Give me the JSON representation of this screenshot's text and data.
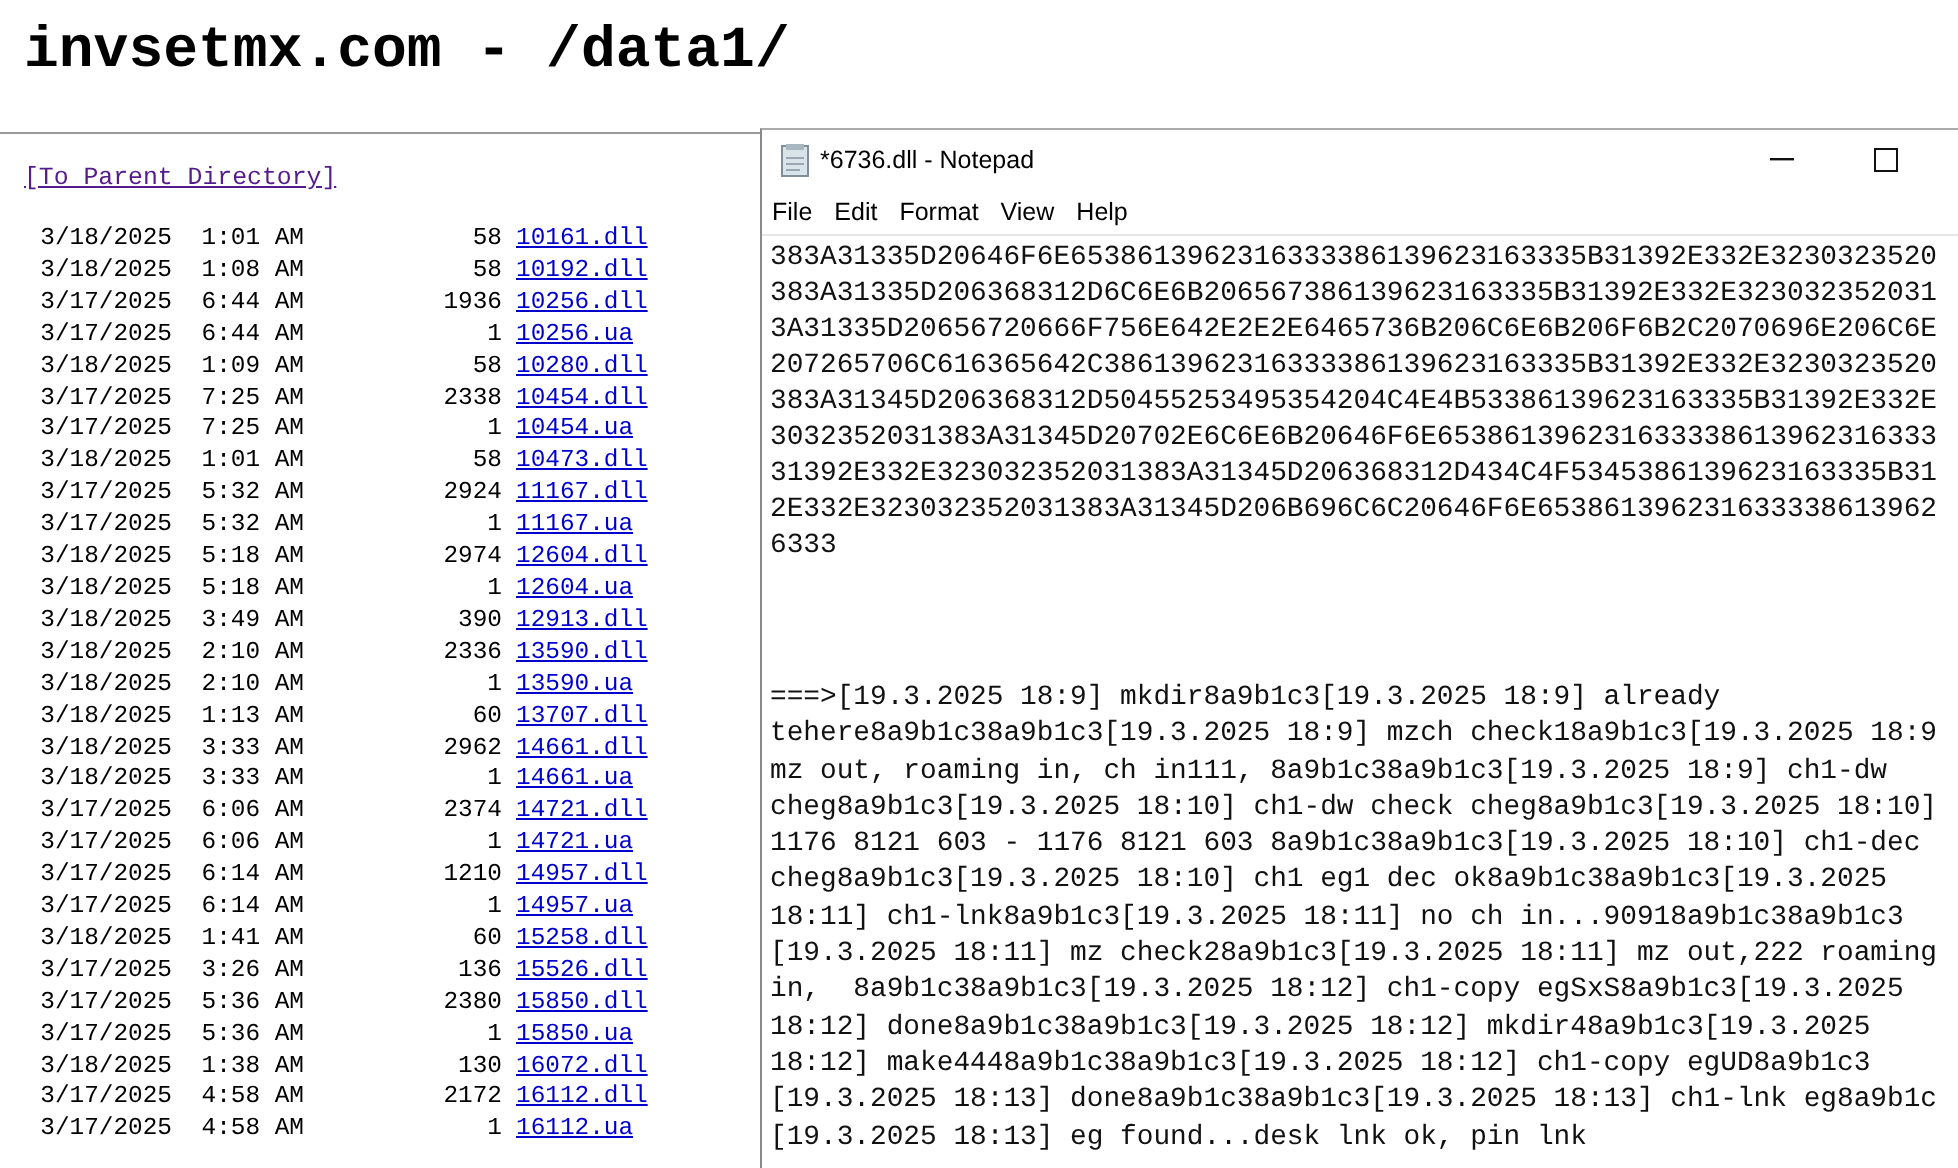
{
  "page": {
    "title": "invsetmx.com - /data1/",
    "parent_link": "[To Parent Directory]",
    "files": [
      {
        "date": "3/18/2025",
        "time": "1:01 AM",
        "size": "58",
        "name": "10161.dll"
      },
      {
        "date": "3/18/2025",
        "time": "1:08 AM",
        "size": "58",
        "name": "10192.dll"
      },
      {
        "date": "3/17/2025",
        "time": "6:44 AM",
        "size": "1936",
        "name": "10256.dll"
      },
      {
        "date": "3/17/2025",
        "time": "6:44 AM",
        "size": "1",
        "name": "10256.ua"
      },
      {
        "date": "3/18/2025",
        "time": "1:09 AM",
        "size": "58",
        "name": "10280.dll"
      },
      {
        "date": "3/17/2025",
        "time": "7:25 AM",
        "size": "2338",
        "name": "10454.dll"
      },
      {
        "date": "3/17/2025",
        "time": "7:25 AM",
        "size": "1",
        "name": "10454.ua"
      },
      {
        "date": "3/18/2025",
        "time": "1:01 AM",
        "size": "58",
        "name": "10473.dll"
      },
      {
        "date": "3/17/2025",
        "time": "5:32 AM",
        "size": "2924",
        "name": "11167.dll"
      },
      {
        "date": "3/17/2025",
        "time": "5:32 AM",
        "size": "1",
        "name": "11167.ua"
      },
      {
        "date": "3/18/2025",
        "time": "5:18 AM",
        "size": "2974",
        "name": "12604.dll"
      },
      {
        "date": "3/18/2025",
        "time": "5:18 AM",
        "size": "1",
        "name": "12604.ua"
      },
      {
        "date": "3/18/2025",
        "time": "3:49 AM",
        "size": "390",
        "name": "12913.dll"
      },
      {
        "date": "3/18/2025",
        "time": "2:10 AM",
        "size": "2336",
        "name": "13590.dll"
      },
      {
        "date": "3/18/2025",
        "time": "2:10 AM",
        "size": "1",
        "name": "13590.ua"
      },
      {
        "date": "3/18/2025",
        "time": "1:13 AM",
        "size": "60",
        "name": "13707.dll"
      },
      {
        "date": "3/18/2025",
        "time": "3:33 AM",
        "size": "2962",
        "name": "14661.dll"
      },
      {
        "date": "3/18/2025",
        "time": "3:33 AM",
        "size": "1",
        "name": "14661.ua"
      },
      {
        "date": "3/17/2025",
        "time": "6:06 AM",
        "size": "2374",
        "name": "14721.dll"
      },
      {
        "date": "3/17/2025",
        "time": "6:06 AM",
        "size": "1",
        "name": "14721.ua"
      },
      {
        "date": "3/17/2025",
        "time": "6:14 AM",
        "size": "1210",
        "name": "14957.dll"
      },
      {
        "date": "3/17/2025",
        "time": "6:14 AM",
        "size": "1",
        "name": "14957.ua"
      },
      {
        "date": "3/18/2025",
        "time": "1:41 AM",
        "size": "60",
        "name": "15258.dll"
      },
      {
        "date": "3/17/2025",
        "time": "3:26 AM",
        "size": "136",
        "name": "15526.dll"
      },
      {
        "date": "3/17/2025",
        "time": "5:36 AM",
        "size": "2380",
        "name": "15850.dll"
      },
      {
        "date": "3/17/2025",
        "time": "5:36 AM",
        "size": "1",
        "name": "15850.ua"
      },
      {
        "date": "3/18/2025",
        "time": "1:38 AM",
        "size": "130",
        "name": "16072.dll"
      },
      {
        "date": "3/17/2025",
        "time": "4:58 AM",
        "size": "2172",
        "name": "16112.dll"
      },
      {
        "date": "3/17/2025",
        "time": "4:58 AM",
        "size": "1",
        "name": "16112.ua"
      }
    ]
  },
  "notepad": {
    "title": "*6736.dll - Notepad",
    "menu": [
      "File",
      "Edit",
      "Format",
      "View",
      "Help"
    ],
    "hex_lines": [
      "383A31335D20646F6E6538613962316333386139623163335B31392E332E3230323520",
      "383A31335D206368312D6C6E6B206567386139623163335B31392E332E323032352031",
      "3A31335D20656720666F756E642E2E2E6465736B206C6E6B206F6B2C2070696E206C6E",
      "207265706C616365642C38613962316333386139623163335B31392E332E3230323520",
      "383A31345D206368312D50455253495354204C4E4B53386139623163335B31392E332E",
      "3032352031383A31345D20702E6C6E6B20646F6E653861396231633338613962316333",
      "31392E332E323032352031383A31345D206368312D434C4F5345386139623163335B31",
      "2E332E323032352031383A31345D206B696C6C20646F6E653861396231633338613962",
      "6333"
    ],
    "log_lines": [
      "===>[19.3.2025 18:9] mkdir8a9b1c3[19.3.2025 18:9] already",
      "tehere8a9b1c38a9b1c3[19.3.2025 18:9] mzch check18a9b1c3[19.3.2025 18:9",
      "mz out, roaming in, ch in111, 8a9b1c38a9b1c3[19.3.2025 18:9] ch1-dw",
      "cheg8a9b1c3[19.3.2025 18:10] ch1-dw check cheg8a9b1c3[19.3.2025 18:10]",
      "1176 8121 603 - 1176 8121 603 8a9b1c38a9b1c3[19.3.2025 18:10] ch1-dec",
      "cheg8a9b1c3[19.3.2025 18:10] ch1 eg1 dec ok8a9b1c38a9b1c3[19.3.2025",
      "18:11] ch1-lnk8a9b1c3[19.3.2025 18:11] no ch in...90918a9b1c38a9b1c3",
      "[19.3.2025 18:11] mz check28a9b1c3[19.3.2025 18:11] mz out,222 roaming",
      "in,  8a9b1c38a9b1c3[19.3.2025 18:12] ch1-copy egSxS8a9b1c3[19.3.2025",
      "18:12] done8a9b1c38a9b1c3[19.3.2025 18:12] mkdir48a9b1c3[19.3.2025",
      "18:12] make4448a9b1c38a9b1c3[19.3.2025 18:12] ch1-copy egUD8a9b1c3",
      "[19.3.2025 18:13] done8a9b1c38a9b1c3[19.3.2025 18:13] ch1-lnk eg8a9b1c",
      "[19.3.2025 18:13] eg found...desk lnk ok, pin lnk"
    ]
  }
}
